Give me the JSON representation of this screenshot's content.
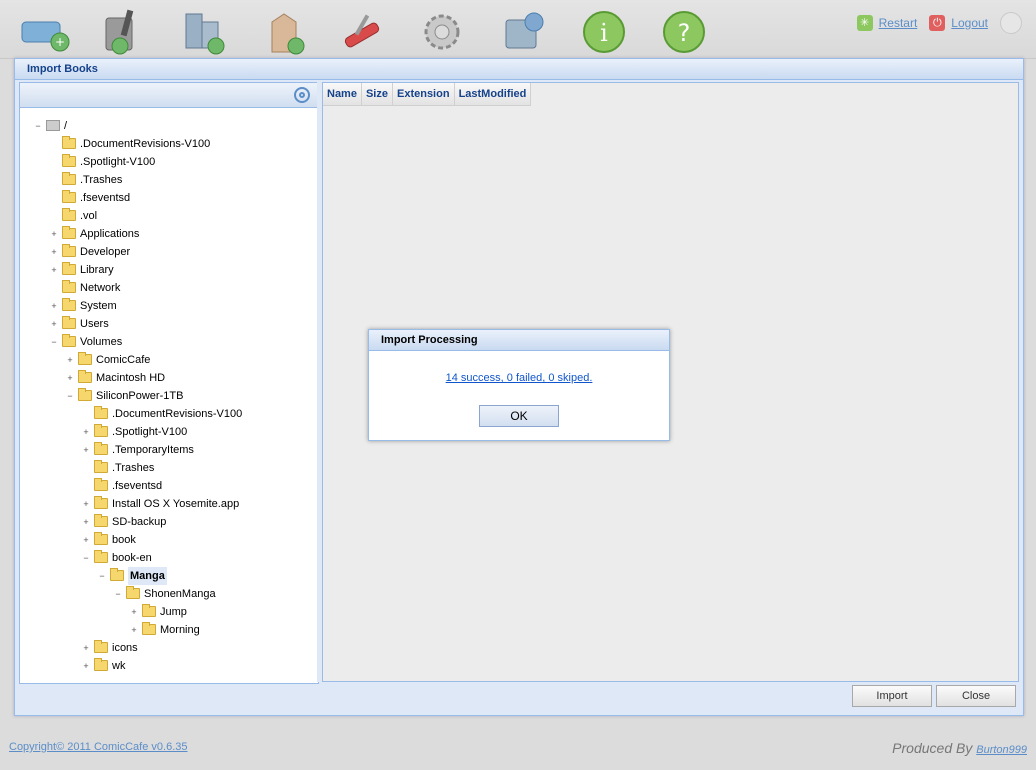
{
  "toolbar": {
    "icons": [
      "add-book-icon",
      "edit-book-icon",
      "import-library-icon",
      "add-tag-icon",
      "tools-icon",
      "settings-icon",
      "export-icon",
      "info-icon",
      "help-icon"
    ],
    "restart_label": "Restart",
    "logout_label": "Logout"
  },
  "window": {
    "title": "Import Books",
    "import_label": "Import",
    "close_label": "Close"
  },
  "grid": {
    "columns": [
      "Name",
      "Size",
      "Extension",
      "LastModified"
    ]
  },
  "tree": {
    "items": [
      {
        "label": "/",
        "toggle": "−",
        "icon": "drive"
      },
      {
        "label": ".DocumentRevisions-V100",
        "toggle": ""
      },
      {
        "label": ".Spotlight-V100",
        "toggle": ""
      },
      {
        "label": ".Trashes",
        "toggle": ""
      },
      {
        "label": ".fseventsd",
        "toggle": ""
      },
      {
        "label": ".vol",
        "toggle": ""
      },
      {
        "label": "Applications",
        "toggle": "+"
      },
      {
        "label": "Developer",
        "toggle": "+"
      },
      {
        "label": "Library",
        "toggle": "+"
      },
      {
        "label": "Network",
        "toggle": ""
      },
      {
        "label": "System",
        "toggle": "+"
      },
      {
        "label": "Users",
        "toggle": "+"
      },
      {
        "label": "Volumes",
        "toggle": "−"
      },
      {
        "label": "ComicCafe",
        "toggle": "+"
      },
      {
        "label": "Macintosh HD",
        "toggle": "+"
      },
      {
        "label": "SiliconPower-1TB",
        "toggle": "−"
      },
      {
        "label": ".DocumentRevisions-V100",
        "toggle": ""
      },
      {
        "label": ".Spotlight-V100",
        "toggle": "+"
      },
      {
        "label": ".TemporaryItems",
        "toggle": "+"
      },
      {
        "label": ".Trashes",
        "toggle": ""
      },
      {
        "label": ".fseventsd",
        "toggle": ""
      },
      {
        "label": "Install OS X Yosemite.app",
        "toggle": "+"
      },
      {
        "label": "SD-backup",
        "toggle": "+"
      },
      {
        "label": "book",
        "toggle": "+"
      },
      {
        "label": "book-en",
        "toggle": "−"
      },
      {
        "label": "Manga",
        "toggle": "−",
        "selected": true
      },
      {
        "label": "ShonenManga",
        "toggle": "−"
      },
      {
        "label": "Jump",
        "toggle": "+"
      },
      {
        "label": "Morning",
        "toggle": "+"
      },
      {
        "label": "icons",
        "toggle": "+"
      },
      {
        "label": "wk",
        "toggle": "+"
      }
    ]
  },
  "dialog": {
    "title": "Import Processing",
    "message": "14 success, 0 failed, 0 skiped.",
    "ok_label": "OK"
  },
  "footer": {
    "copyright": "Copyright© 2011 ComicCafe v0.6.35",
    "produced_by": "Produced By",
    "author": "Burton999"
  },
  "colors": {
    "accent": "#15428b",
    "link": "#5b8ec8",
    "panel_border": "#99bbe8"
  }
}
